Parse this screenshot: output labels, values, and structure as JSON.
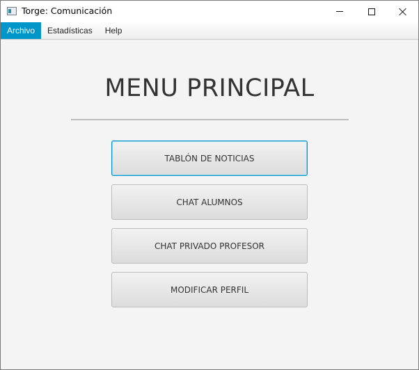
{
  "window": {
    "title": "Torge: Comunicación"
  },
  "menubar": {
    "items": [
      {
        "label": "Archivo",
        "active": true
      },
      {
        "label": "Estadísticas",
        "active": false
      },
      {
        "label": "Help",
        "active": false
      }
    ]
  },
  "main": {
    "heading": "MENU PRINCIPAL",
    "buttons": [
      {
        "label": "TABLÓN DE NOTICIAS",
        "focused": true
      },
      {
        "label": "CHAT ALUMNOS",
        "focused": false
      },
      {
        "label": "CHAT PRIVADO PROFESOR",
        "focused": false
      },
      {
        "label": "MODIFICAR PERFIL",
        "focused": false
      }
    ]
  },
  "colors": {
    "accent": "#0096c9",
    "background": "#f4f4f4",
    "text": "#333333"
  },
  "icons": {
    "app": "app-window-icon",
    "minimize": "minimize-icon",
    "maximize": "maximize-icon",
    "close": "close-icon"
  }
}
